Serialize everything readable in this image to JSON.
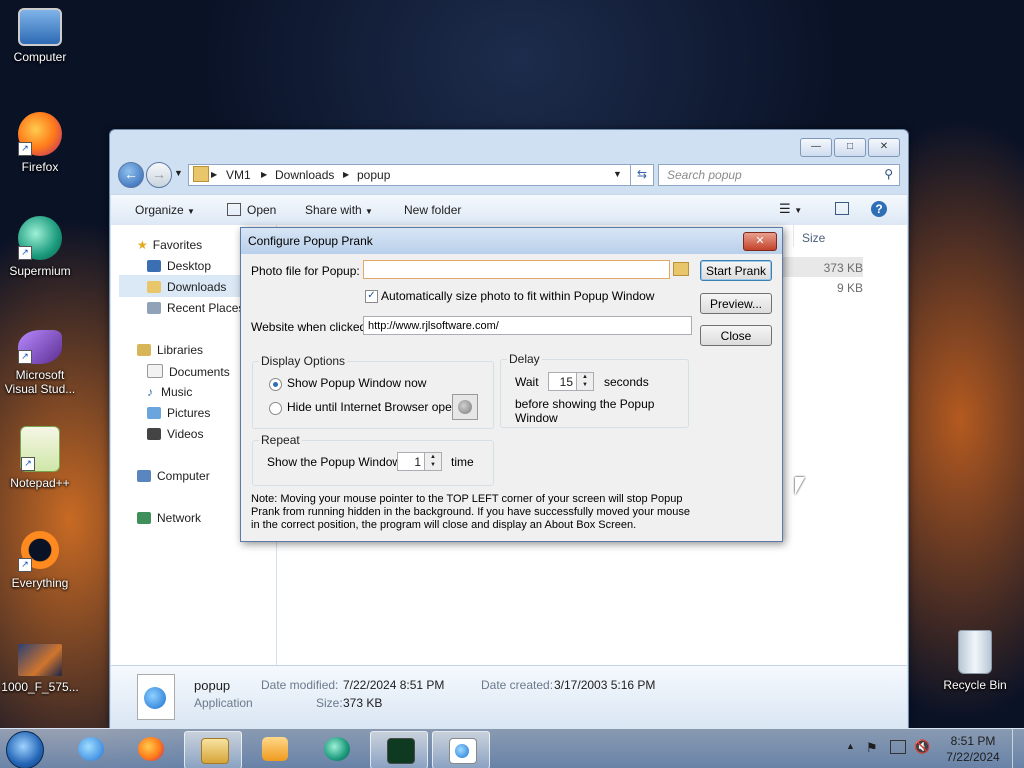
{
  "desktop": {
    "icons": [
      {
        "label": "Computer"
      },
      {
        "label": "Firefox"
      },
      {
        "label": "Supermium"
      },
      {
        "label": "Microsoft Visual Stud..."
      },
      {
        "label": "Notepad++"
      },
      {
        "label": "Everything"
      },
      {
        "label": "1000_F_575..."
      },
      {
        "label": "Recycle Bin"
      }
    ]
  },
  "explorer": {
    "breadcrumb": [
      "VM1",
      "Downloads",
      "popup"
    ],
    "search_placeholder": "Search popup",
    "toolbar": {
      "organize": "Organize",
      "open": "Open",
      "share_with": "Share with",
      "new_folder": "New folder"
    },
    "nav": {
      "favorites": "Favorites",
      "desktop": "Desktop",
      "downloads": "Downloads",
      "recent_places": "Recent Places",
      "libraries": "Libraries",
      "documents": "Documents",
      "music": "Music",
      "pictures": "Pictures",
      "videos": "Videos",
      "computer": "Computer",
      "network": "Network"
    },
    "columns": {
      "size": "Size"
    },
    "rows": [
      {
        "size": "373 KB"
      },
      {
        "size": "9 KB"
      }
    ],
    "details": {
      "name": "popup",
      "type": "Application",
      "date_modified_label": "Date modified:",
      "date_modified": "7/22/2024 8:51 PM",
      "date_created_label": "Date created:",
      "date_created": "3/17/2003 5:16 PM",
      "size_label": "Size:",
      "size": "373 KB"
    }
  },
  "dialog": {
    "title": "Configure Popup Prank",
    "photo_label": "Photo file for Popup:",
    "photo_value": "",
    "auto_size_label": "Automatically size photo to fit within Popup Window",
    "auto_size_checked": true,
    "website_label": "Website when clicked:",
    "website_value": "http://www.rjlsoftware.com/",
    "buttons": {
      "start": "Start Prank",
      "preview": "Preview...",
      "close": "Close"
    },
    "display_options": {
      "title": "Display Options",
      "opt1": "Show Popup Window now",
      "opt2": "Hide until Internet Browser opens",
      "selected": "opt1"
    },
    "delay": {
      "title": "Delay",
      "wait": "Wait",
      "value": "15",
      "seconds": "seconds",
      "before": "before showing the Popup Window"
    },
    "repeat": {
      "title": "Repeat",
      "show": "Show the Popup Window",
      "value": "1",
      "time": "time"
    },
    "note": "Note: Moving your mouse pointer to the TOP LEFT corner of your screen will stop Popup Prank from running hidden in the background. If you have successfully moved your mouse in the correct position, the program will close and display an About Box Screen."
  },
  "taskbar": {
    "time": "8:51 PM",
    "date": "7/22/2024"
  },
  "colors": {
    "title_bar": "#b9cfea",
    "taskbar": "#7c96be",
    "accent": "#2f6fb6"
  }
}
